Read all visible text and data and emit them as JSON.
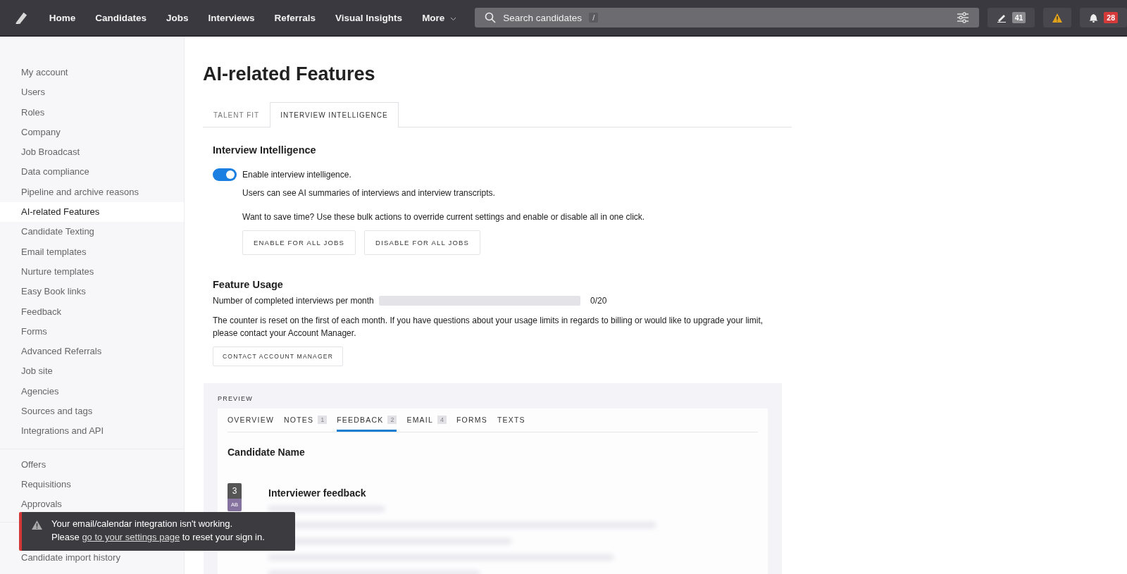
{
  "nav": {
    "items": [
      {
        "label": "Home"
      },
      {
        "label": "Candidates"
      },
      {
        "label": "Jobs"
      },
      {
        "label": "Interviews"
      },
      {
        "label": "Referrals"
      },
      {
        "label": "Visual Insights"
      }
    ],
    "more": "More"
  },
  "search": {
    "placeholder": "Search candidates",
    "shortcut": "/"
  },
  "top_actions": [
    {
      "kind": "edit",
      "badge": "41"
    },
    {
      "kind": "warning"
    },
    {
      "kind": "notifications",
      "badge": "28"
    }
  ],
  "sidebar": {
    "groups": [
      [
        {
          "label": "My account",
          "selected": false
        },
        {
          "label": "Users",
          "selected": false
        },
        {
          "label": "Roles",
          "selected": false
        },
        {
          "label": "Company",
          "selected": false
        },
        {
          "label": "Job Broadcast",
          "selected": false
        },
        {
          "label": "Data compliance",
          "selected": false
        },
        {
          "label": "Pipeline and archive reasons",
          "selected": false
        },
        {
          "label": "AI-related Features",
          "selected": true
        },
        {
          "label": "Candidate Texting",
          "selected": false
        },
        {
          "label": "Email templates",
          "selected": false
        },
        {
          "label": "Nurture templates",
          "selected": false
        },
        {
          "label": "Easy Book links",
          "selected": false
        },
        {
          "label": "Feedback",
          "selected": false
        },
        {
          "label": "Forms",
          "selected": false
        },
        {
          "label": "Advanced Referrals",
          "selected": false
        },
        {
          "label": "Job site",
          "selected": false
        },
        {
          "label": "Agencies",
          "selected": false
        },
        {
          "label": "Sources and tags",
          "selected": false
        },
        {
          "label": "Integrations and API",
          "selected": false
        }
      ],
      [
        {
          "label": "Offers",
          "selected": false
        },
        {
          "label": "Requisitions",
          "selected": false
        },
        {
          "label": "Approvals",
          "selected": false
        }
      ],
      [
        {
          "label": "Candidate import history",
          "selected": false
        }
      ]
    ]
  },
  "page": {
    "title": "AI-related Features",
    "tabs": [
      {
        "label": "TALENT FIT",
        "selected": false
      },
      {
        "label": "INTERVIEW INTELLIGENCE",
        "selected": true
      }
    ],
    "section_title": "Interview Intelligence",
    "toggle": {
      "on": true,
      "label": "Enable interview intelligence.",
      "help": "Users can see AI summaries of interviews and interview transcripts."
    },
    "bulk_note": "Want to save time? Use these bulk actions to override current settings and enable or disable all in one click.",
    "bulk_buttons": [
      "ENABLE FOR ALL JOBS",
      "DISABLE FOR ALL JOBS"
    ],
    "usage": {
      "title": "Feature Usage",
      "metric_label": "Number of completed interviews per month",
      "level": 0,
      "reading": "0/20",
      "note": "The counter is reset on the first of each month. If you have questions about your usage limits in regards to billing or would like to upgrade your limit, please contact your Account Manager.",
      "button": "CONTACT ACCOUNT MANAGER"
    }
  },
  "preview": {
    "label": "PREVIEW",
    "tabs": [
      {
        "label": "OVERVIEW",
        "selected": false
      },
      {
        "label": "NOTES",
        "count": "1",
        "selected": false
      },
      {
        "label": "FEEDBACK",
        "count": "2",
        "selected": true
      },
      {
        "label": "EMAIL",
        "count": "4",
        "selected": false
      },
      {
        "label": "FORMS",
        "selected": false
      },
      {
        "label": "TEXTS",
        "selected": false
      }
    ],
    "candidate_name": "Candidate Name",
    "feedback": {
      "score": "3",
      "initials": "AB",
      "title": "Interviewer feedback"
    }
  },
  "toast": {
    "line1": "Your email/calendar integration isn't working.",
    "before": "Please ",
    "link": "go to your settings page",
    "after": " to reset your sign in."
  }
}
